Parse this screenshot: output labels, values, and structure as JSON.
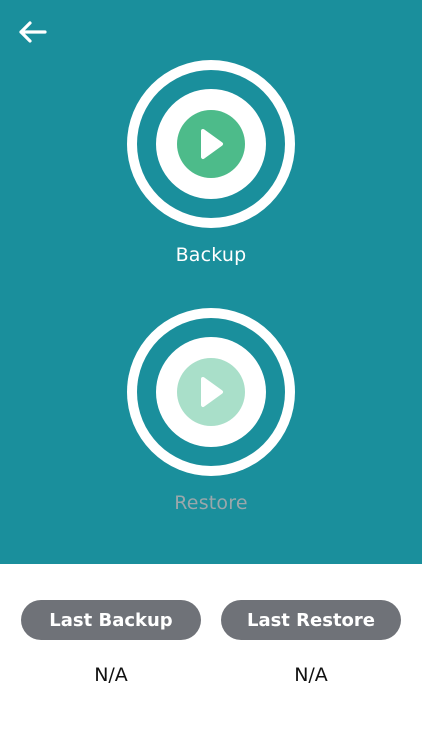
{
  "header": {
    "back_icon": "arrow-left-icon"
  },
  "actions": {
    "backup": {
      "label": "Backup",
      "icon": "play-icon",
      "enabled": true
    },
    "restore": {
      "label": "Restore",
      "icon": "play-icon",
      "enabled": false
    }
  },
  "info": {
    "last_backup": {
      "label": "Last Backup",
      "value": "N/A"
    },
    "last_restore": {
      "label": "Last Restore",
      "value": "N/A"
    }
  },
  "colors": {
    "panel_teal": "#1a8f9c",
    "play_green": "#4dbb8a",
    "play_green_disabled": "#a9dfc9",
    "pill_gray": "#6f7278",
    "label_disabled": "#9aa7ab"
  }
}
